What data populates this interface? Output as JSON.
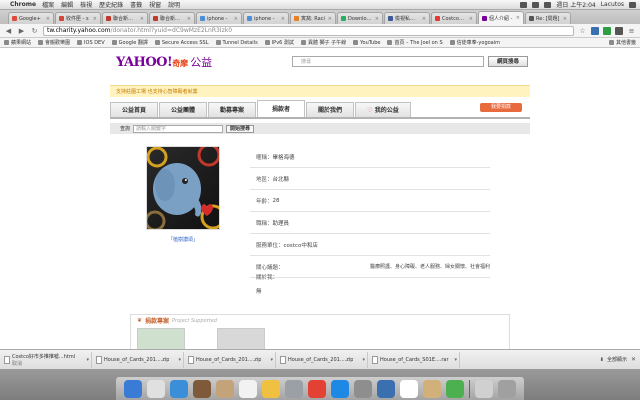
{
  "menubar": {
    "app": "Chrome",
    "items": [
      "檔案",
      "編輯",
      "檢視",
      "歷史紀錄",
      "書籤",
      "視窗",
      "說明"
    ],
    "clock": "週日 上午2:04",
    "user": "Lacutos"
  },
  "tabs": [
    {
      "title": "Google+",
      "color": "#dd4b39"
    },
    {
      "title": "收件匣 - s",
      "color": "#d14836"
    },
    {
      "title": "聯合新聞網",
      "color": "#c0392b"
    },
    {
      "title": "聯合新聞網",
      "color": "#c0392b"
    },
    {
      "title": "iphone -",
      "color": "#4a90d9"
    },
    {
      "title": "iphone -",
      "color": "#4a90d9"
    },
    {
      "title": "寅窩: Raci",
      "color": "#e67e22"
    },
    {
      "title": "Download",
      "color": "#27ae60"
    },
    {
      "title": "檢視私人訊",
      "color": "#3b5998"
    },
    {
      "title": "Costco好市",
      "color": "#e53935"
    },
    {
      "title": "個人介紹 -",
      "color": "#7b0099",
      "active": true
    },
    {
      "title": "Re: [問題]",
      "color": "#555555"
    }
  ],
  "address": {
    "host": "tw.charity.yahoo.com",
    "path": "/donator.html?yuid=dC9wMzE2LnR3Izk0"
  },
  "bookmarks": {
    "items": [
      "蘋果網站",
      "會搬歡樂園",
      "IOS DEV",
      "Google 翻譯",
      "Secure Access SSL",
      "Tunnel Details",
      "IPv6 測試",
      "異體 獅子 子午線",
      "YouTube",
      "首頁 – The Joel on S",
      "信徒車奉-yogoaim"
    ],
    "other": "其他書籤"
  },
  "site": {
    "logo": "YAHOO!",
    "logo_cn": "奇摩",
    "logo_sub": "公益",
    "search_placeholder": "搜尋",
    "search_button": "網頁搜尋",
    "banner": "支持莊園工場 也支持心智障礙者就業",
    "nav": [
      {
        "label": "公益首頁"
      },
      {
        "label": "公益團體"
      },
      {
        "label": "勸募專案"
      },
      {
        "label": "捐款者",
        "active": true
      },
      {
        "label": "關於我們"
      },
      {
        "label": "我的公益",
        "heart": true
      }
    ],
    "donate_button": "我要捐款",
    "sub_search_label": "查詢",
    "sub_search_placeholder": "請輸入關鍵字",
    "sub_search_button": "開始搜尋"
  },
  "profile": {
    "caption": "「植樹讚頌」",
    "fields": [
      {
        "label": "暱稱：",
        "value": "畢格海德"
      },
      {
        "label": "地區：",
        "value": "台北縣"
      },
      {
        "label": "年齡：",
        "value": "28"
      },
      {
        "label": "職稱：",
        "value": "助理員"
      },
      {
        "label": "服務單位：",
        "value": "costco中和店"
      }
    ],
    "concern_label": "關心議題：",
    "concern_value": "醫療照護、身心障礙、老人服務、婦女關懷、社會福利",
    "intro_label": "關於我：",
    "intro_value": "無"
  },
  "projects": {
    "title": "捐款專案",
    "title_en": "Project Supported"
  },
  "downloads": [
    {
      "name": "Costco好市多推推噓...html",
      "status": "取消"
    },
    {
      "name": "House_of_Cards_201....zip"
    },
    {
      "name": "House_of_Cards_201....zip"
    },
    {
      "name": "House_of_Cards_201....zip"
    },
    {
      "name": "House_of_Cards_S01E....rar"
    }
  ],
  "download_show_all": "全部顯示",
  "dock_colors": [
    "#3a7bd5",
    "#e0e0e0",
    "#3b8fd8",
    "#7f5a3a",
    "#c4a37a",
    "#f2f2f2",
    "#f0c040",
    "#9aa0a6",
    "#e34133",
    "#1e88e5",
    "#8e8e8e",
    "#3a6fb0",
    "#ffffff",
    "#d1b07a",
    "#4caf50",
    "#d0d0d0",
    "#a0a0a0"
  ]
}
